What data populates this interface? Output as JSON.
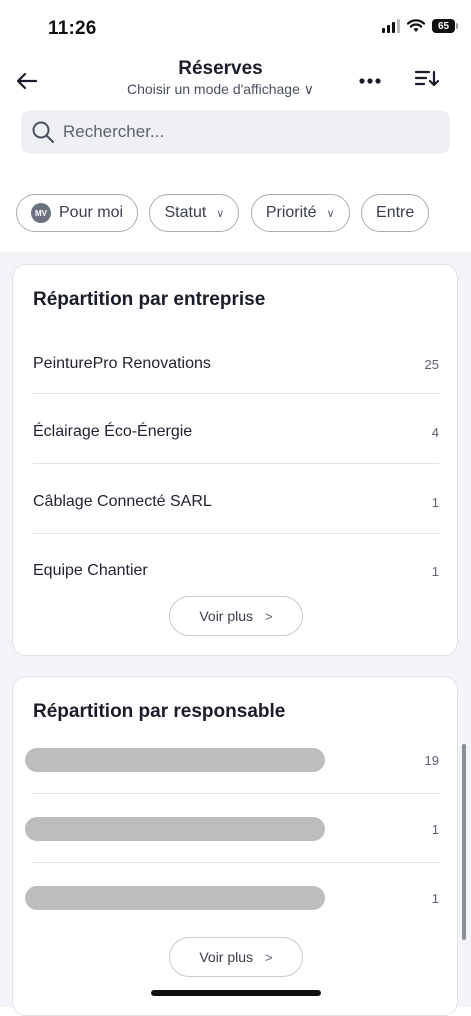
{
  "status_bar": {
    "time": "11:26",
    "battery": "65"
  },
  "header": {
    "title": "Réserves",
    "view_mode_label": "Choisir un mode d'affichage ∨"
  },
  "search": {
    "placeholder": "Rechercher..."
  },
  "filters": {
    "mine": {
      "avatar_initials": "MV",
      "label": "Pour moi"
    },
    "status": "Statut",
    "priority": "Priorité",
    "company_partial": "Entre"
  },
  "company_breakdown": {
    "title": "Répartition par entreprise",
    "rows": [
      {
        "label": "PeinturePro Renovations",
        "count": "25"
      },
      {
        "label": "Éclairage Éco-Énergie",
        "count": "4"
      },
      {
        "label": "Câblage Connecté SARL",
        "count": "1"
      },
      {
        "label": "Equipe Chantier",
        "count": "1"
      }
    ],
    "more_label": "Voir plus"
  },
  "manager_breakdown": {
    "title": "Répartition par responsable",
    "rows": [
      {
        "label": "",
        "count": "19"
      },
      {
        "label": "",
        "count": "1"
      },
      {
        "label": "",
        "count": "1"
      }
    ],
    "more_label": "Voir plus"
  },
  "colors": {
    "accent_text": "#1a1d29",
    "background": "#f3f4f7",
    "chip_border": "#a8adb8",
    "redaction": "#bdbdbd"
  },
  "icons": {
    "back": "arrow-left-icon",
    "more": "more-horizontal-icon",
    "sort": "sort-icon",
    "search": "search-icon",
    "chevron_right": "chevron-right-icon",
    "chevron_down": "chevron-down-icon"
  }
}
